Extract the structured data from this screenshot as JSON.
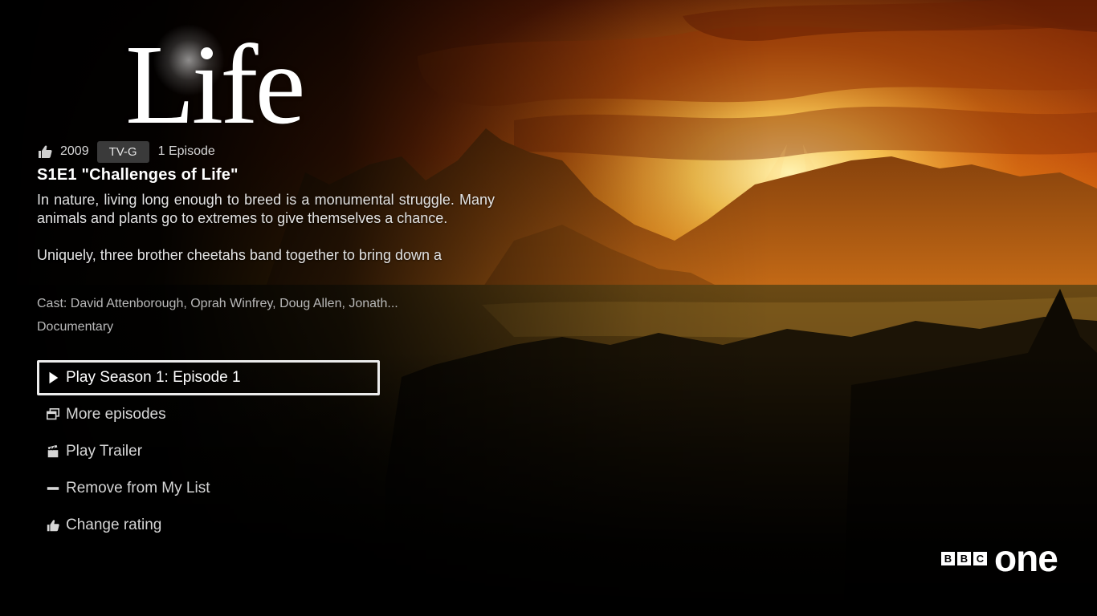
{
  "show": {
    "logo_title": "Life",
    "year": "2009",
    "maturity_rating": "TV-G",
    "episode_count": "1 Episode",
    "rating_icon": "thumbs-up-icon",
    "episode_title": "S1E1 \"Challenges of Life\"",
    "synopsis": [
      "In nature, living long enough to breed is a monumental struggle. Many animals and plants go to extremes to give themselves a chance.",
      "Uniquely, three brother cheetahs band together to bring down a"
    ],
    "cast": "Cast: David Attenborough, Oprah Winfrey, Doug Allen, Jonath...",
    "genre": "Documentary"
  },
  "actions": [
    {
      "label": "Play Season 1: Episode 1",
      "icon": "play-icon",
      "selected": true
    },
    {
      "label": "More episodes",
      "icon": "episodes-icon",
      "selected": false
    },
    {
      "label": "Play Trailer",
      "icon": "clapperboard-icon",
      "selected": false
    },
    {
      "label": "Remove from My List",
      "icon": "minus-icon",
      "selected": false
    },
    {
      "label": "Change rating",
      "icon": "thumbs-up-icon",
      "selected": false
    }
  ],
  "channel": {
    "network_letters": [
      "B",
      "B",
      "C"
    ],
    "name": "one"
  },
  "colors": {
    "focus_border": "#ececec",
    "background": "#000000",
    "sky_orange": "#f08a16"
  }
}
